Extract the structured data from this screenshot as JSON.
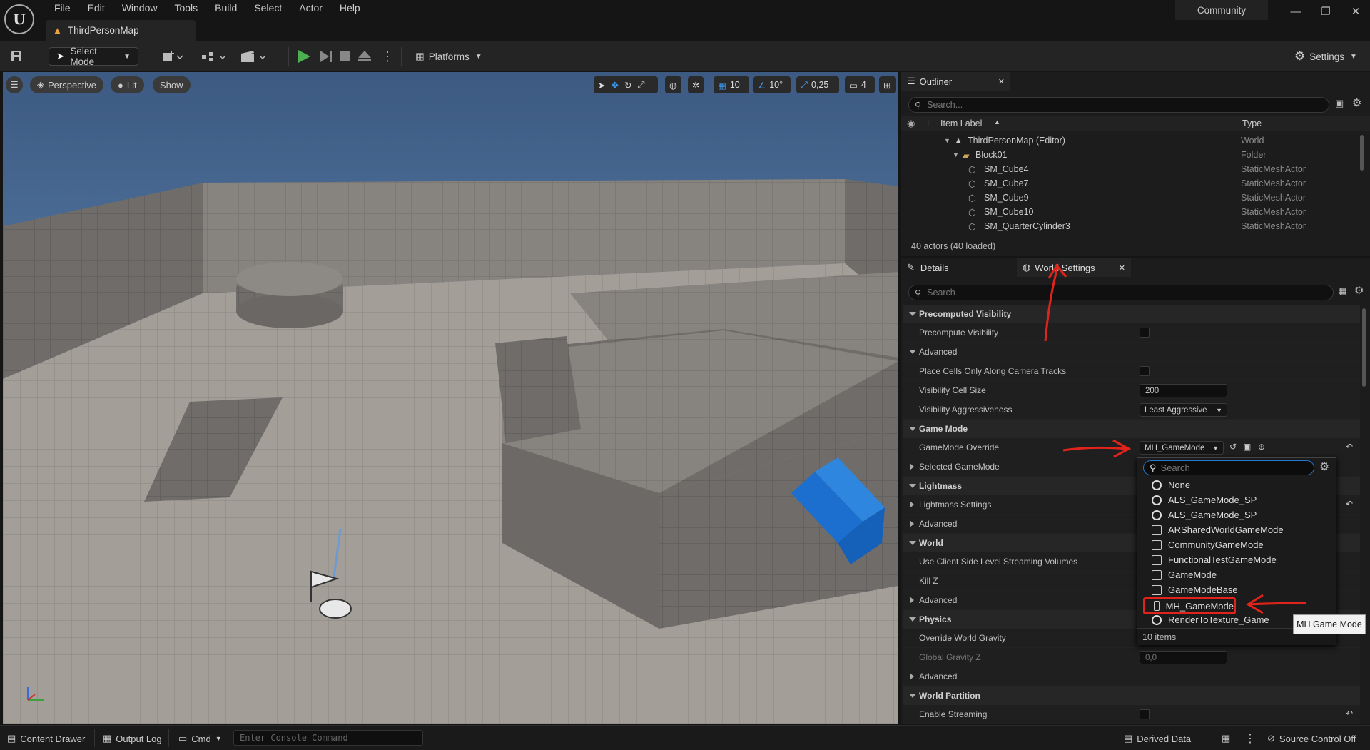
{
  "app": {
    "logo": "U",
    "menu": [
      "File",
      "Edit",
      "Window",
      "Tools",
      "Build",
      "Select",
      "Actor",
      "Help"
    ],
    "map_tab": "ThirdPersonMap",
    "community": "Community"
  },
  "toolbar": {
    "select_mode": "Select Mode",
    "platforms": "Platforms",
    "settings": "Settings"
  },
  "viewport": {
    "perspective": "Perspective",
    "lit": "Lit",
    "show": "Show",
    "grid_snap": "10",
    "rot_snap": "10°",
    "scale_snap": "0,25",
    "cam_speed": "4"
  },
  "outliner": {
    "tab": "Outliner",
    "search_placeholder": "Search...",
    "col_label": "Item Label",
    "col_type": "Type",
    "rows": [
      {
        "label": "ThirdPersonMap (Editor)",
        "type": "World"
      },
      {
        "label": "Block01",
        "type": "Folder"
      },
      {
        "label": "SM_Cube4",
        "type": "StaticMeshActor"
      },
      {
        "label": "SM_Cube7",
        "type": "StaticMeshActor"
      },
      {
        "label": "SM_Cube9",
        "type": "StaticMeshActor"
      },
      {
        "label": "SM_Cube10",
        "type": "StaticMeshActor"
      },
      {
        "label": "SM_QuarterCylinder3",
        "type": "StaticMeshActor"
      }
    ],
    "count": "40 actors (40 loaded)"
  },
  "details": {
    "tab_details": "Details",
    "tab_world": "World Settings",
    "search_placeholder": "Search",
    "cats": {
      "precomputed": "Precomputed Visibility",
      "game_mode": "Game Mode",
      "lightmass": "Lightmass",
      "world": "World",
      "physics": "Physics",
      "world_partition": "World Partition"
    },
    "props": {
      "precompute_vis": "Precompute Visibility",
      "advanced": "Advanced",
      "place_cells": "Place Cells Only Along Camera Tracks",
      "vis_cell_size": "Visibility Cell Size",
      "vis_cell_size_val": "200",
      "vis_aggr": "Visibility Aggressiveness",
      "vis_aggr_val": "Least Aggressive",
      "gm_override": "GameMode Override",
      "gm_override_val": "MH_GameMode",
      "selected_gm": "Selected GameMode",
      "lightmass_settings": "Lightmass Settings",
      "client_side": "Use Client Side Level Streaming Volumes",
      "kill_z": "Kill Z",
      "override_gravity": "Override World Gravity",
      "global_gravity": "Global Gravity Z",
      "global_gravity_val": "0,0",
      "enable_streaming": "Enable Streaming"
    }
  },
  "dropdown": {
    "search_placeholder": "Search",
    "options": [
      {
        "label": "None",
        "icon": "circle-icon"
      },
      {
        "label": "ALS_GameMode_SP",
        "icon": "circle-icon"
      },
      {
        "label": "ALS_GameMode_SP",
        "icon": "circle-icon"
      },
      {
        "label": "ARSharedWorldGameMode",
        "icon": "class-icon"
      },
      {
        "label": "CommunityGameMode",
        "icon": "class-icon"
      },
      {
        "label": "FunctionalTestGameMode",
        "icon": "class-icon"
      },
      {
        "label": "GameMode",
        "icon": "class-icon"
      },
      {
        "label": "GameModeBase",
        "icon": "class-icon"
      },
      {
        "label": "MH_GameMode",
        "icon": "class-icon"
      },
      {
        "label": "RenderToTexture_Game",
        "icon": "circle-icon"
      }
    ],
    "count": "10 items",
    "tooltip": "MH Game Mode"
  },
  "statusbar": {
    "content_drawer": "Content Drawer",
    "output_log": "Output Log",
    "cmd": "Cmd",
    "console_placeholder": "Enter Console Command",
    "derived_data": "Derived Data",
    "source_control": "Source Control Off"
  },
  "colors": {
    "accent": "#1f7ad0",
    "annotation": "#e0241c",
    "play": "#4caf50"
  }
}
